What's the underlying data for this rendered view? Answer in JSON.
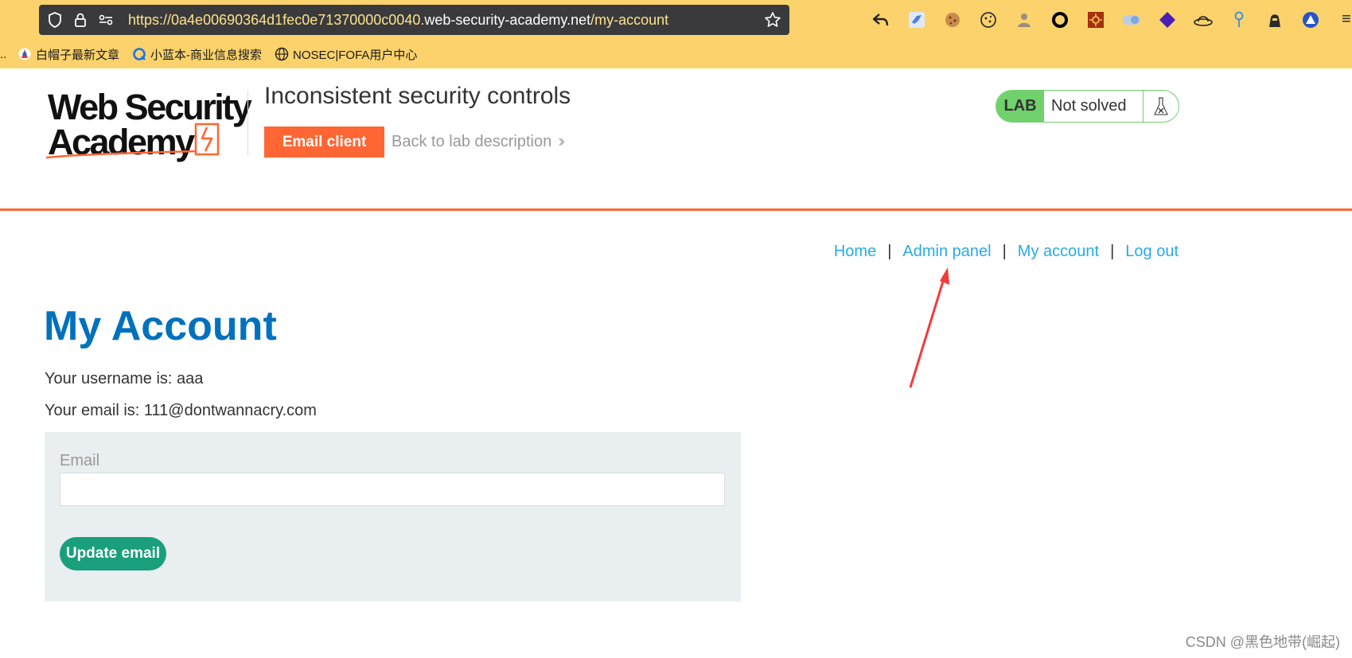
{
  "browser": {
    "url_prefix": "https://0a4e00690364d1fec0e71370000c0040.",
    "url_host": "web-security-academy.net",
    "url_path": "/my-account",
    "bookmarks": [
      {
        "label": "白帽子最新文章",
        "icon": "baimaozi-icon"
      },
      {
        "label": "小蓝本-商业信息搜索",
        "icon": "xiaolanben-icon"
      },
      {
        "label": "NOSEC|FOFA用户中心",
        "icon": "globe-icon"
      }
    ],
    "extensions": [
      "back-arrow-icon",
      "bird-icon",
      "cookie-icon",
      "cookie-editor-icon",
      "spy-icon",
      "ring-icon",
      "sun-icon",
      "toggle-icon",
      "diamond-icon",
      "hat-icon",
      "pin-icon",
      "hacker-icon",
      "triangle-icon"
    ]
  },
  "lab": {
    "logo_line1": "Web Security",
    "logo_line2": "Academy",
    "title": "Inconsistent security controls",
    "email_client_label": "Email client",
    "back_label": "Back to lab description",
    "status_tag": "LAB",
    "status_text": "Not solved",
    "accent_color": "#ff6633",
    "status_color": "#70d16d"
  },
  "nav": {
    "home": "Home",
    "admin_panel": "Admin panel",
    "my_account": "My account",
    "log_out": "Log out",
    "separator": "|"
  },
  "page": {
    "title": "My Account",
    "username_line": "Your username is: aaa",
    "email_line": "Your email is: 111@dontwannacry.com",
    "form": {
      "email_label": "Email",
      "email_value": "",
      "update_button": "Update email"
    }
  },
  "watermark": "CSDN @黑色地带(崛起)"
}
